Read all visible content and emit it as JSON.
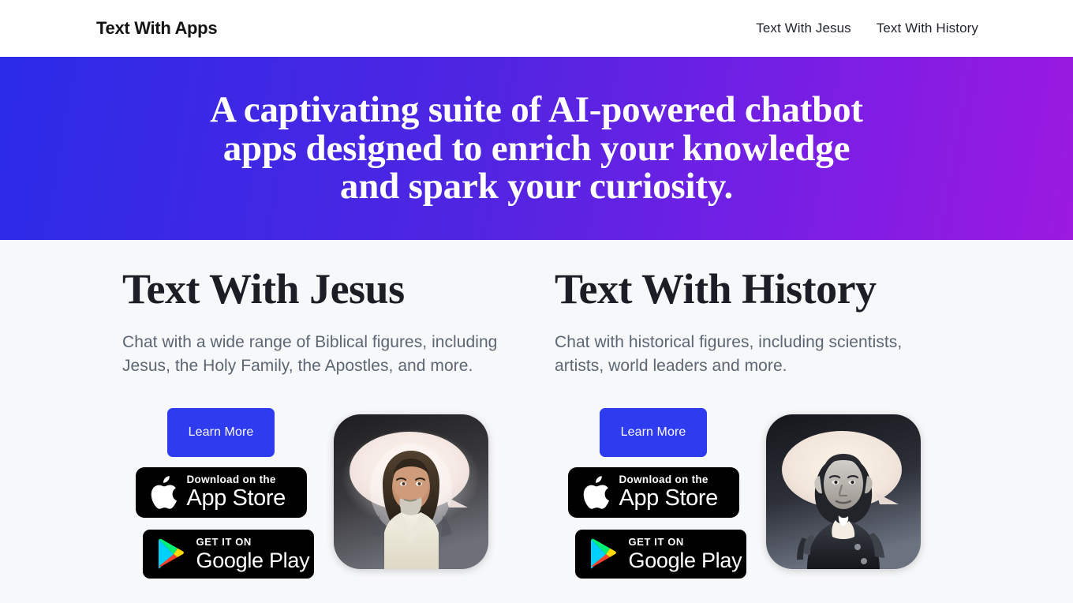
{
  "nav": {
    "brand": "Text With Apps",
    "links": [
      {
        "label": "Text With Jesus"
      },
      {
        "label": "Text With History"
      }
    ]
  },
  "hero": {
    "headline": "A captivating suite of AI-powered chatbot apps designed to enrich your knowledge and spark your curiosity.",
    "gradient_from": "#2b2be8",
    "gradient_to": "#9c19e0",
    "text_color": "#ffffff"
  },
  "apps": [
    {
      "title": "Text With Jesus",
      "description": "Chat with a wide range of Biblical figures, including Jesus, the Holy Family, the Apostles, and more.",
      "learn_more_label": "Learn More",
      "appstore": {
        "small": "Download on the",
        "big": "App Store"
      },
      "googleplay": {
        "small": "GET IT ON",
        "big": "Google Play"
      },
      "icon_name": "text-with-jesus-app-icon"
    },
    {
      "title": "Text With History",
      "description": "Chat with historical figures, including scientists, artists, world leaders and more.",
      "learn_more_label": "Learn More",
      "appstore": {
        "small": "Download on the",
        "big": "App Store"
      },
      "googleplay": {
        "small": "GET IT ON",
        "big": "Google Play"
      },
      "icon_name": "text-with-history-app-icon"
    }
  ],
  "colors": {
    "accent_blue": "#2f3bef",
    "page_background": "#f7f8fa",
    "heading": "#1b1e24",
    "body_text": "#5c6673",
    "badge_black": "#000000"
  }
}
